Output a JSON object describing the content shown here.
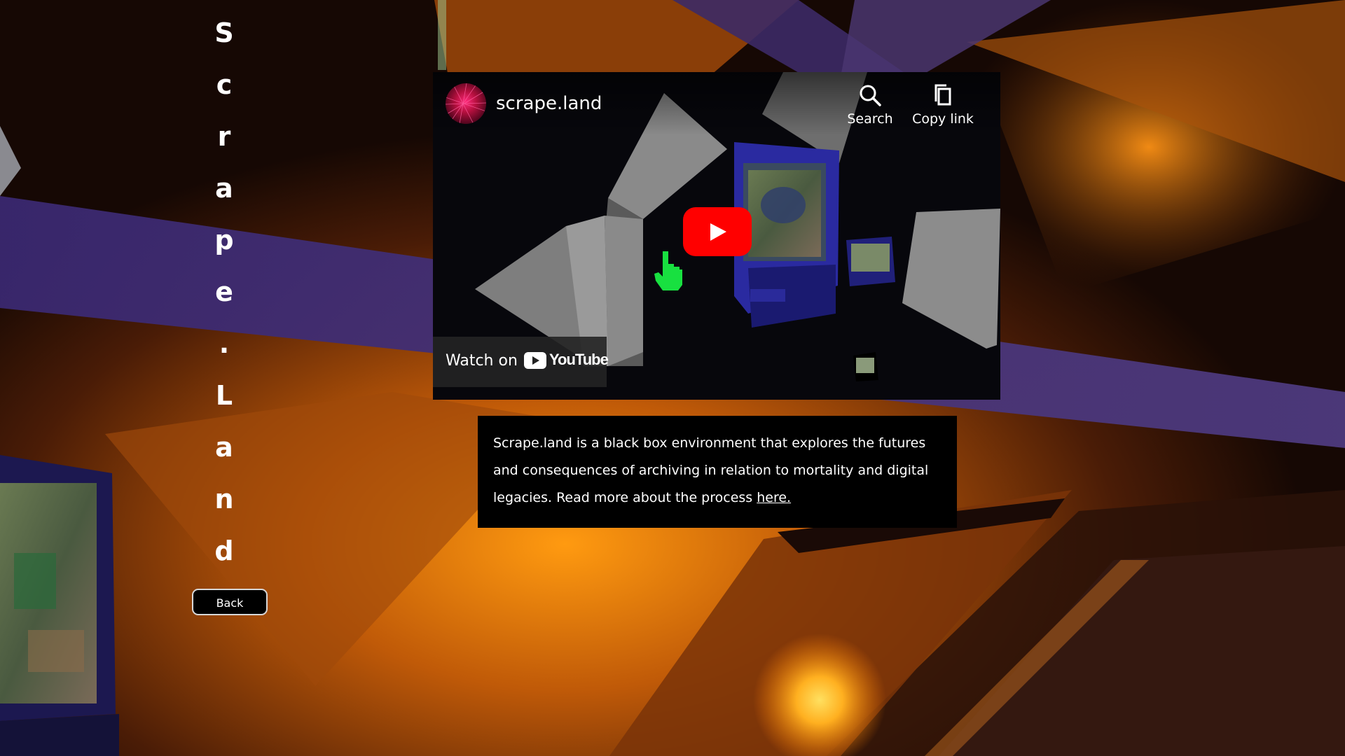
{
  "title_letters": [
    "S",
    "c",
    "r",
    "a",
    "p",
    "e",
    ".",
    "L",
    "a",
    "n",
    "d"
  ],
  "back_label": "Back",
  "video": {
    "channel_name": "scrape.land",
    "search_label": "Search",
    "copy_link_label": "Copy link",
    "watch_on_label": "Watch on",
    "platform_label": "YouTube"
  },
  "description": {
    "text": "Scrape.land is a black box environment that explores the futures and consequences of archiving in relation to mortality and digital legacies. Read more about the process ",
    "link_label": "here."
  },
  "colors": {
    "orange": "#e07a10",
    "purple": "#3e2a6a",
    "youtube_red": "#ff0000"
  }
}
